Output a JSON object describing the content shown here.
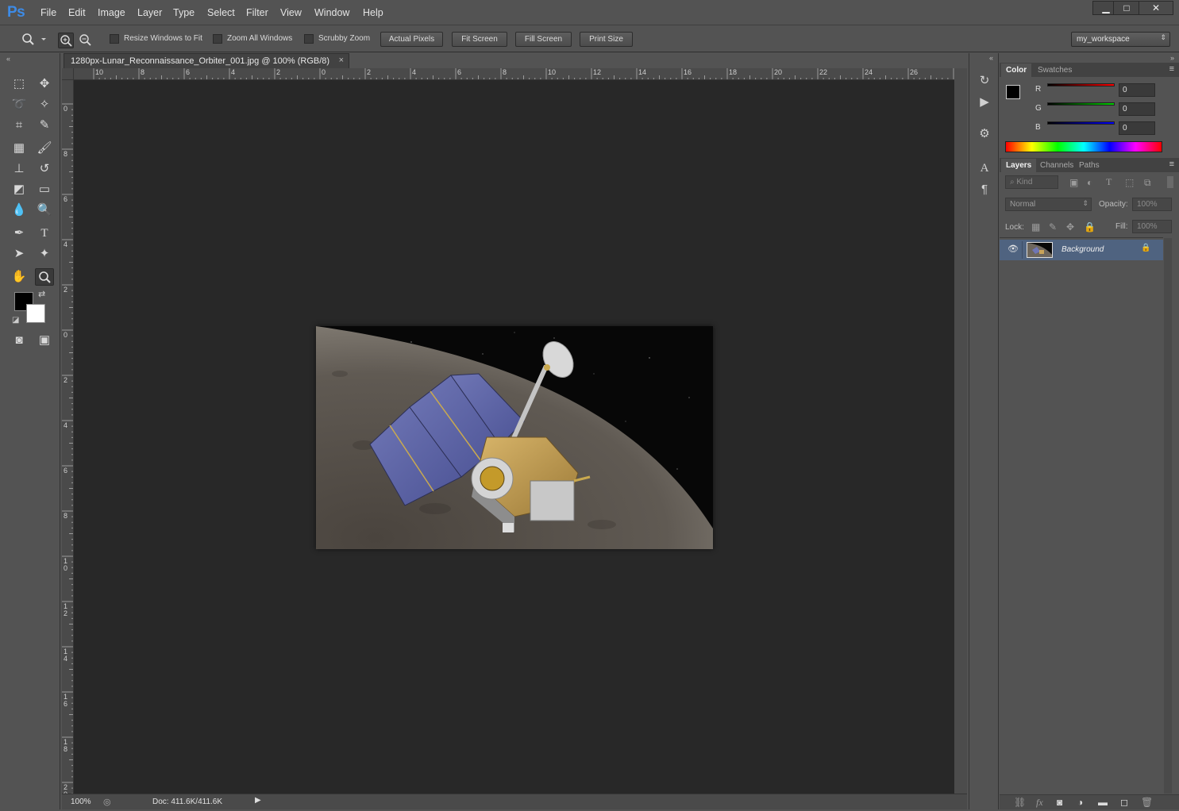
{
  "app": {
    "logo": "Ps"
  },
  "menu": [
    "File",
    "Edit",
    "Image",
    "Layer",
    "Type",
    "Select",
    "Filter",
    "View",
    "Window",
    "Help"
  ],
  "window_controls": {
    "minimize": "▁",
    "maximize": "□",
    "close": "✕"
  },
  "options": {
    "resize_windows": "Resize Windows to Fit",
    "zoom_all": "Zoom All Windows",
    "scrubby_zoom": "Scrubby Zoom",
    "actual_pixels": "Actual Pixels",
    "fit_screen": "Fit Screen",
    "fill_screen": "Fill Screen",
    "print_size": "Print Size",
    "workspace": "my_workspace"
  },
  "document": {
    "tab_title": "1280px-Lunar_Reconnaissance_Orbiter_001.jpg @ 100% (RGB/8)",
    "close": "×"
  },
  "ruler": {
    "top_labels": [
      "10",
      "8",
      "6",
      "4",
      "2",
      "0",
      "2",
      "4",
      "6",
      "8",
      "10",
      "12",
      "14",
      "16",
      "18",
      "20",
      "22",
      "24",
      "26",
      "2"
    ],
    "left_labels": [
      "0",
      "8",
      "6",
      "4",
      "2",
      "0",
      "2",
      "4",
      "6",
      "8",
      "1 0",
      "1 2",
      "1 4",
      "1 6",
      "1 8",
      "2 0"
    ]
  },
  "status": {
    "zoom": "100%",
    "doc": "Doc: 411.6K/411.6K"
  },
  "color_panel": {
    "tabs": [
      "Color",
      "Swatches"
    ],
    "channels": [
      {
        "label": "R",
        "value": "0",
        "color": "#ff0000"
      },
      {
        "label": "G",
        "value": "0",
        "color": "#00d000"
      },
      {
        "label": "B",
        "value": "0",
        "color": "#0000ff"
      }
    ]
  },
  "layers_panel": {
    "tabs": [
      "Layers",
      "Channels",
      "Paths"
    ],
    "kind_label": "Kind",
    "blend_mode": "Normal",
    "opacity_label": "Opacity:",
    "opacity_value": "100%",
    "lock_label": "Lock:",
    "fill_label": "Fill:",
    "fill_value": "100%",
    "layers": [
      {
        "name": "Background",
        "visible": true,
        "locked": true
      }
    ]
  },
  "colors": {
    "accent": "#3d8be6",
    "selected_layer": "#4f6380"
  }
}
